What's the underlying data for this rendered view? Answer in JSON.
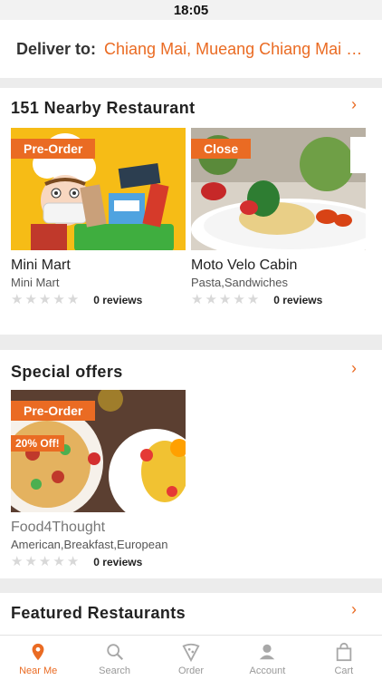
{
  "status_bar": {
    "time": "18:05"
  },
  "deliver": {
    "label": "Deliver to:",
    "location": "Chiang Mai, Mueang Chiang Mai District, Chiang Mai"
  },
  "nearby": {
    "title": "151 Nearby Restaurant",
    "chevron": "›",
    "cards": [
      {
        "badge": "Pre-Order",
        "name": "Mini Mart",
        "subtitle": "Mini Mart",
        "rating": 0,
        "reviews": "0 reviews"
      },
      {
        "badge": "Close",
        "name": "Moto Velo Cabin",
        "subtitle": "Pasta,Sandwiches",
        "rating": 0,
        "reviews": "0 reviews"
      }
    ]
  },
  "offers": {
    "title": "Special offers",
    "chevron": "›",
    "cards": [
      {
        "badge": "Pre-Order",
        "discount": "20% Off!",
        "name": "Food4Thought",
        "subtitle": "American,Breakfast,European",
        "rating": 0,
        "reviews": "0 reviews"
      }
    ]
  },
  "featured": {
    "title": "Featured Restaurants",
    "chevron": "›"
  },
  "tabs": [
    {
      "label": "Near Me",
      "icon": "location-pin-icon",
      "active": true
    },
    {
      "label": "Search",
      "icon": "search-icon",
      "active": false
    },
    {
      "label": "Order",
      "icon": "pizza-slice-icon",
      "active": false
    },
    {
      "label": "Account",
      "icon": "person-icon",
      "active": false
    },
    {
      "label": "Cart",
      "icon": "shopping-bag-icon",
      "active": false
    }
  ],
  "colors": {
    "accent": "#ea6b23",
    "background": "#ececec",
    "inactive": "#999999"
  }
}
